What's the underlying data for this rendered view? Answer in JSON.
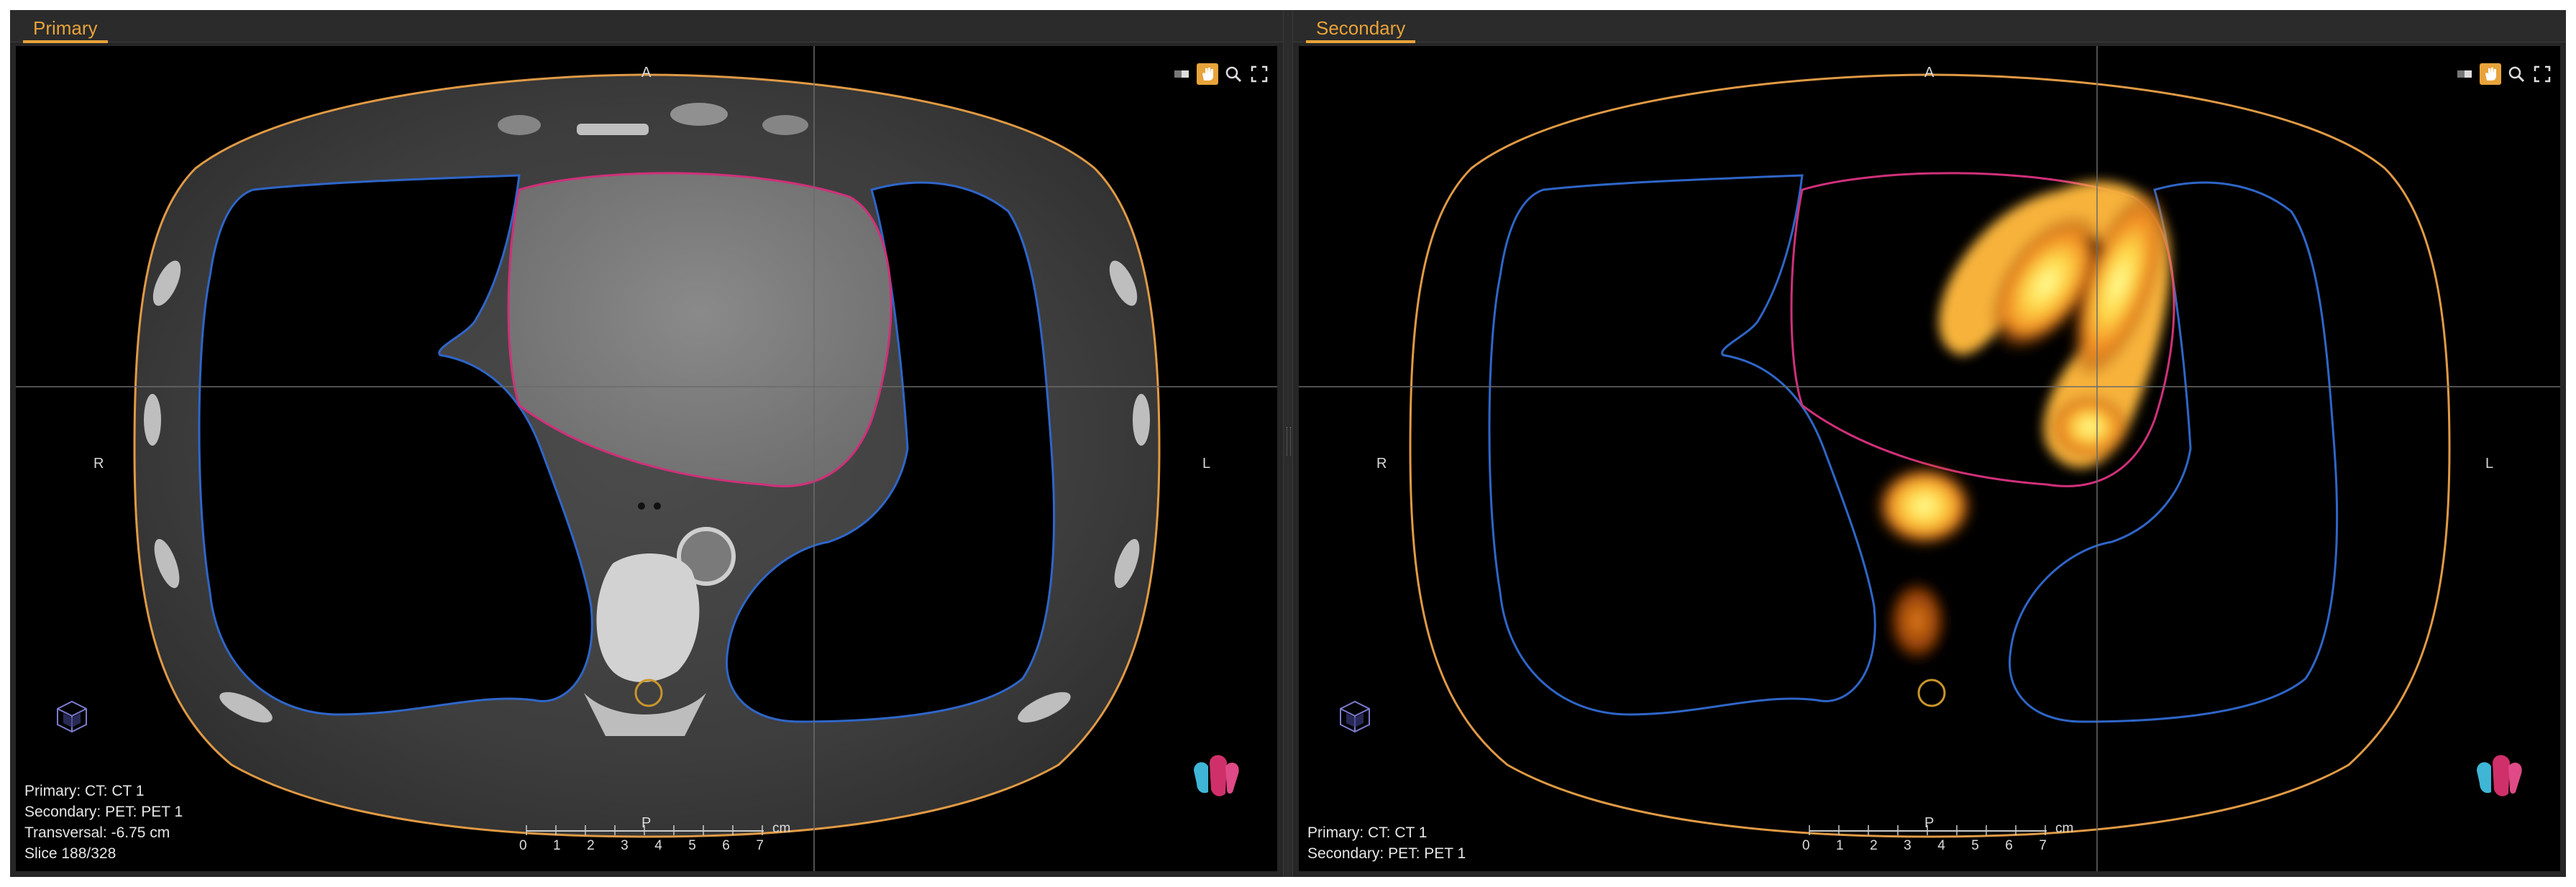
{
  "primary": {
    "tab_label": "Primary",
    "orientation": {
      "anterior": "A",
      "posterior": "P",
      "right": "R",
      "left": "L"
    },
    "info": {
      "line1": "Primary: CT: CT 1",
      "line2": "Secondary: PET: PET 1",
      "line3": "Transversal: -6.75 cm",
      "line4": "Slice 188/328"
    }
  },
  "secondary": {
    "tab_label": "Secondary",
    "orientation": {
      "anterior": "A",
      "posterior": "P",
      "right": "R",
      "left": "L"
    },
    "info": {
      "line1": "Primary: CT: CT 1",
      "line2": "Secondary: PET: PET 1"
    }
  },
  "scale": {
    "unit": "cm",
    "ticks": [
      "0",
      "1",
      "2",
      "3",
      "4",
      "5",
      "6",
      "7"
    ]
  },
  "toolbar_icons": [
    "window-level-icon",
    "pan-hand-icon",
    "zoom-icon",
    "fullscreen-icon"
  ],
  "active_tool": "pan-hand-icon",
  "contour_colors": {
    "body": "#e09a45",
    "lungs": "#2f66c8",
    "heart": "#d0307a",
    "spinal_cord": "#c9962a"
  },
  "accent_color": "#e8a33b"
}
